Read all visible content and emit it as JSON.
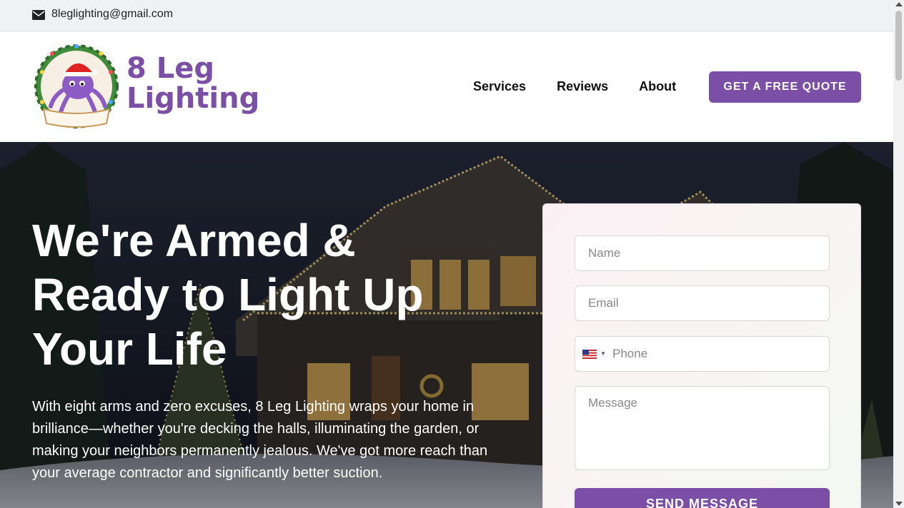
{
  "topbar": {
    "email": "8leglighting@gmail.com",
    "icon": "mail-icon"
  },
  "header": {
    "logo_line1": "8 Leg",
    "logo_line2": "Lighting",
    "nav": [
      "Services",
      "Reviews",
      "About"
    ],
    "cta": "GET A FREE QUOTE"
  },
  "hero": {
    "title": "We're Armed & Ready to Light Up Your Life",
    "text": "With eight arms and zero excuses, 8 Leg Lighting wraps your home in brilliance—whether you're decking the halls, illuminating the garden, or making your neighbors permanently jealous. We've got more reach than your average contractor and significantly better suction."
  },
  "form": {
    "name_placeholder": "Name",
    "email_placeholder": "Email",
    "phone_placeholder": "Phone",
    "message_placeholder": "Message",
    "submit": "SEND MESSAGE",
    "phone_country_icon": "us-flag-icon"
  },
  "colors": {
    "brand": "#7b4fa6",
    "topbar_bg": "#f0f1f3"
  }
}
